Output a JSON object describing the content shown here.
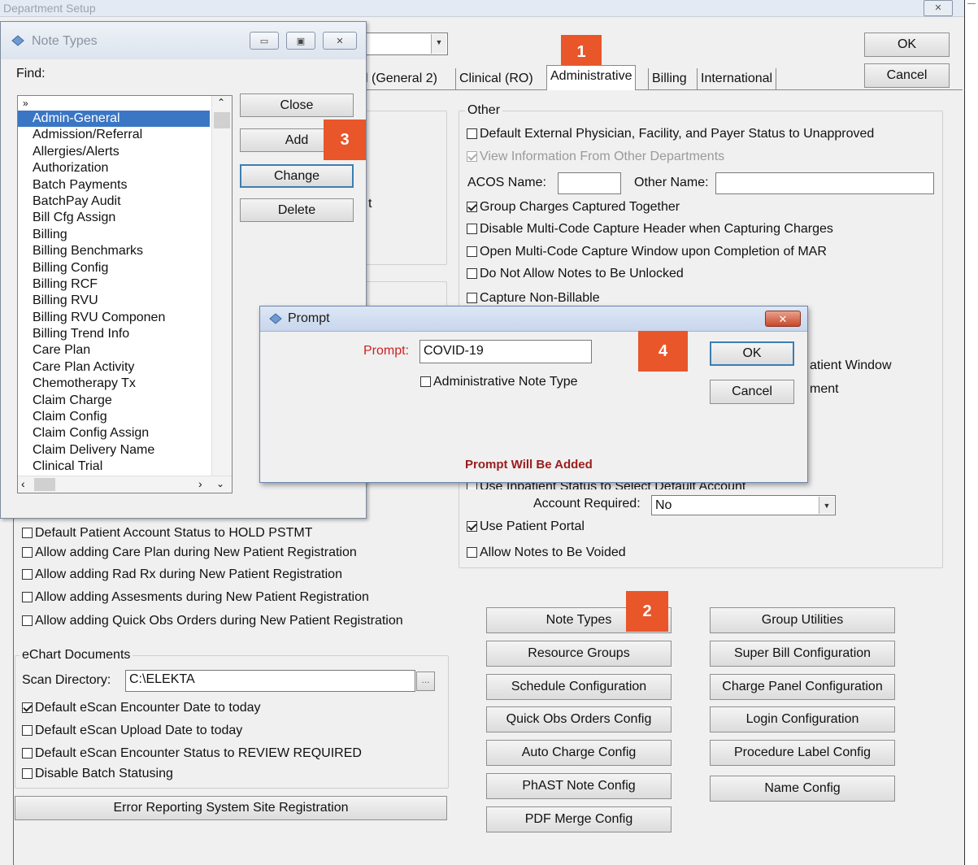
{
  "main_window": {
    "title": "Department Setup",
    "close_glyph": "✕",
    "ok_label": "OK",
    "cancel_label": "Cancel"
  },
  "tabs": [
    {
      "label": "l (General 2)"
    },
    {
      "label": "Clinical (RO)"
    },
    {
      "label": "Administrative",
      "selected": true
    },
    {
      "label": "Billing"
    },
    {
      "label": "International"
    }
  ],
  "obscured_fragment": "t",
  "other_group": {
    "label": "Other",
    "default_external": "Default External Physician, Facility, and Payer Status to Unapproved",
    "view_info": "View Information From Other Departments",
    "acos_name_label": "ACOS Name:",
    "acos_name_value": "",
    "other_name_label": "Other Name:",
    "other_name_value": "",
    "group_charges": "Group Charges Captured Together",
    "disable_multicode": "Disable Multi-Code Capture Header when Capturing Charges",
    "open_multicode": "Open Multi-Code Capture Window upon Completion of MAR",
    "no_unlock": "Do Not Allow Notes to Be Unlocked",
    "capture_nonbillable": "Capture Non-Billable",
    "fragment_patient_window": "atient Window",
    "fragment_ment": "ment",
    "use_inpatient": "Use Inpatient Status to Select Default Account",
    "account_required_label": "Account Required:",
    "account_required_value": "No",
    "use_patient_portal": "Use Patient Portal",
    "allow_voided": "Allow Notes to Be Voided"
  },
  "left_checks": {
    "hold_pstmt": "Default Patient Account Status to HOLD PSTMT",
    "care_plan": "Allow adding Care Plan during New Patient Registration",
    "rad_rx": "Allow adding Rad Rx during New Patient Registration",
    "assessments": "Allow adding Assesments during New Patient Registration",
    "quick_obs": "Allow adding Quick Obs Orders during New Patient Registration"
  },
  "echart": {
    "label": "eChart Documents",
    "scan_dir_label": "Scan Directory:",
    "scan_dir_value": "C:\\ELEKTA",
    "browse": "...",
    "encounter_today": "Default eScan Encounter Date to today",
    "upload_today": "Default eScan Upload Date to today",
    "review_required": "Default eScan Encounter Status to REVIEW REQUIRED",
    "disable_batch": "Disable Batch Statusing"
  },
  "error_reporting_button": "Error Reporting System Site Registration",
  "config_buttons_left": [
    "Note Types",
    "Resource Groups",
    "Schedule Configuration",
    "Quick Obs Orders Config",
    "Auto Charge Config",
    "PhAST Note Config",
    "PDF Merge Config"
  ],
  "config_buttons_right": [
    "Group Utilities",
    "Super Bill Configuration",
    "Charge Panel Configuration",
    "Login Configuration",
    "Procedure Label Config",
    "Name Config"
  ],
  "note_types_dialog": {
    "title": "Note Types",
    "find_label": "Find:",
    "list_marker": "»",
    "items": [
      "Admin-General",
      "Admission/Referral",
      "Allergies/Alerts",
      "Authorization",
      "Batch Payments",
      "BatchPay Audit",
      "Bill Cfg Assign",
      "Billing",
      "Billing Benchmarks",
      "Billing Config",
      "Billing RCF",
      "Billing RVU",
      "Billing RVU Componen",
      "Billing Trend Info",
      "Care Plan",
      "Care Plan Activity",
      "Chemotherapy Tx",
      "Claim Charge",
      "Claim Config",
      "Claim Config Assign",
      "Claim Delivery Name",
      "Clinical Trial"
    ],
    "close_label": "Close",
    "add_label": "Add",
    "change_label": "Change",
    "delete_label": "Delete"
  },
  "prompt_dialog": {
    "title": "Prompt",
    "prompt_label": "Prompt:",
    "prompt_value": "COVID-19",
    "admin_note_type": "Administrative Note Type",
    "ok_label": "OK",
    "cancel_label": "Cancel",
    "status_text": "Prompt Will Be Added"
  },
  "badges": [
    "1",
    "2",
    "3",
    "4"
  ],
  "colors": {
    "badge": "#e8562a",
    "selection": "#3a76c4",
    "status_text": "#9b1c1c",
    "prompt_label": "#cc2222"
  }
}
